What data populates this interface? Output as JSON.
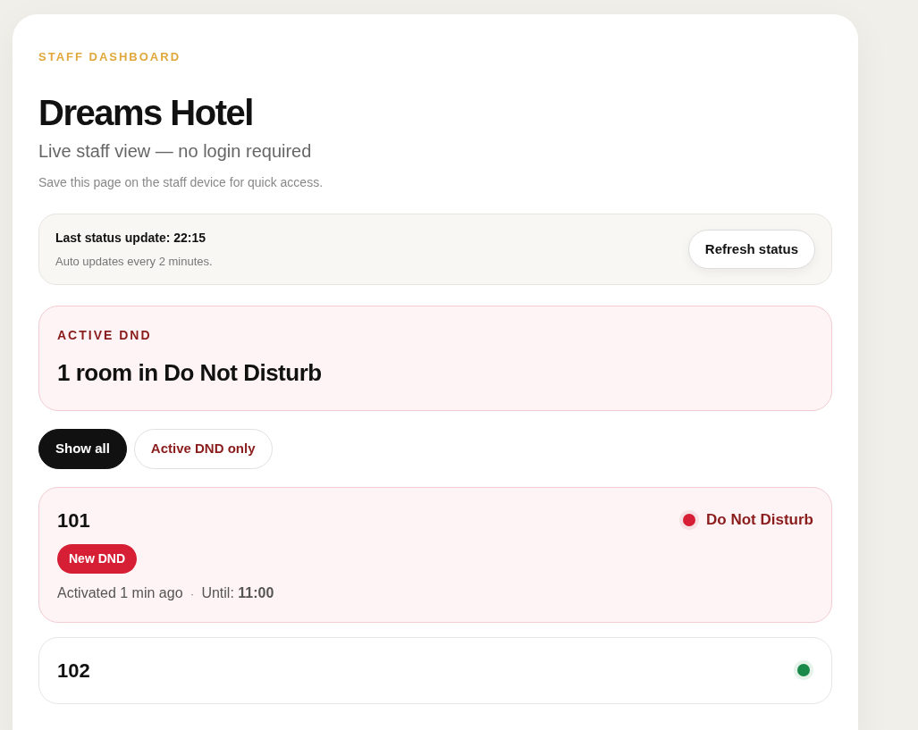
{
  "header": {
    "eyebrow": "STAFF DASHBOARD",
    "title": "Dreams Hotel",
    "subtitle": "Live staff view — no login required",
    "hint": "Save this page on the staff device for quick access."
  },
  "status": {
    "last_update": "Last status update: 22:15",
    "auto_note": "Auto updates every 2 minutes.",
    "refresh_button": "Refresh status"
  },
  "summary": {
    "eyebrow": "ACTIVE DND",
    "headline": "1 room in Do Not Disturb"
  },
  "filters": [
    {
      "label": "Show all",
      "selected": true
    },
    {
      "label": "Active DND only",
      "selected": false
    }
  ],
  "rooms": [
    {
      "number": "101",
      "dnd": true,
      "color": "#d61f35",
      "status_label": "Do Not Disturb",
      "badge": "New DND",
      "activated": "Activated 1 min ago",
      "separator": "·",
      "until_label": "Until:",
      "until_time": "11:00"
    },
    {
      "number": "102",
      "dnd": false,
      "color": "#1a8a4a"
    }
  ]
}
